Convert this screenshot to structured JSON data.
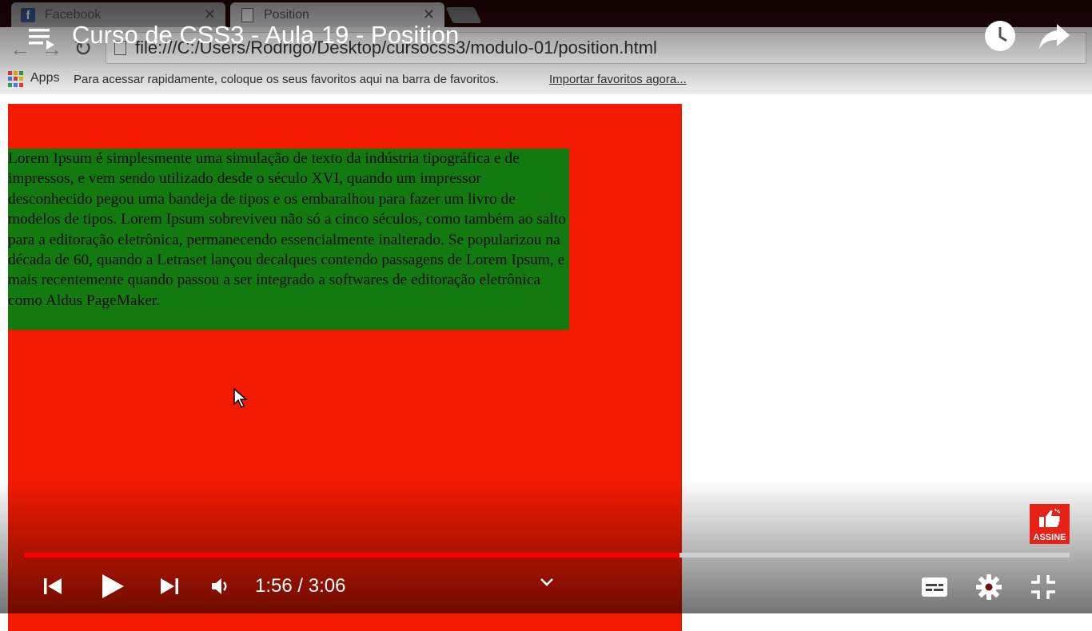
{
  "browser": {
    "tabs": [
      {
        "label": "Facebook",
        "icon": "facebook-icon"
      },
      {
        "label": "Position",
        "icon": "page-icon"
      }
    ],
    "close_glyph": "✕",
    "url": "file:///C:/Users/Rodrigo/Desktop/cursocss3/modulo-01/position.html",
    "bookmarks": {
      "apps_label": "Apps",
      "hint": "Para acessar rapidamente, coloque os seus favoritos aqui na barra de favoritos.",
      "import_link": "Importar favoritos agora..."
    }
  },
  "page": {
    "paragraph": "Lorem Ipsum é simplesmente uma simulação de texto da indústria tipográfica e de impressos, e vem sendo utilizado desde o século XVI, quando um impressor desconhecido pegou uma bandeja de tipos e os embaralhou para fazer um livro de modelos de tipos. Lorem Ipsum sobreviveu não só a cinco séculos, como também ao salto para a editoração eletrônica, permanecendo essencialmente inalterado. Se popularizou na década de 60, quando a Letraset lançou decalques contendo passagens de Lorem Ipsum, e mais recentemente quando passou a ser integrado a softwares de editoração eletrônica como Aldus PageMaker.",
    "colors": {
      "outer_box": "#f41a00",
      "inner_box": "#137a10"
    }
  },
  "player": {
    "title": "Curso de CSS3 - Aula 19 - Position",
    "time": "1:56 / 3:06",
    "progress_fraction": 0.627,
    "subscribe_label": "ASSINE",
    "accent": "#ff0000"
  }
}
